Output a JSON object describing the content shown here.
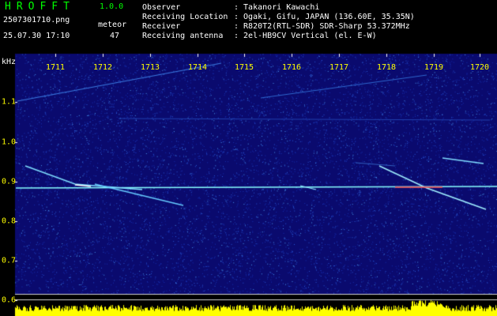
{
  "header": {
    "app_title": "HROFFT",
    "app_version": "1.0.0",
    "file_name": "2507301710.png",
    "datetime": "25.07.30 17:10",
    "meteor_label": "meteor",
    "meteor_count": "47"
  },
  "info": [
    {
      "key": "Observer",
      "value": ": Takanori Kawachi"
    },
    {
      "key": "Receiving Location",
      "value": ": Ogaki, Gifu, JAPAN (136.60E, 35.35N)"
    },
    {
      "key": "Receiver",
      "value": ": R820T2(RTL-SDR) SDR-Sharp 53.372MHz"
    },
    {
      "key": "Receiving antenna",
      "value": ": 2el-HB9CV Vertical (el. E-W)"
    }
  ],
  "spectrogram": {
    "y_unit": "kHz",
    "x_ticks": [
      "1711",
      "1712",
      "1713",
      "1714",
      "1715",
      "1716",
      "1717",
      "1718",
      "1719",
      "1720"
    ],
    "y_ticks": [
      "1.1",
      "1.0",
      "0.9",
      "0.8",
      "0.7",
      "0.6"
    ],
    "colors": {
      "background": "#0a0a6e",
      "carrier": "#88ffff",
      "bottom_bar": "#ffff00",
      "text_accent": "#00ff00",
      "tick_labels": "#ffff00"
    }
  }
}
